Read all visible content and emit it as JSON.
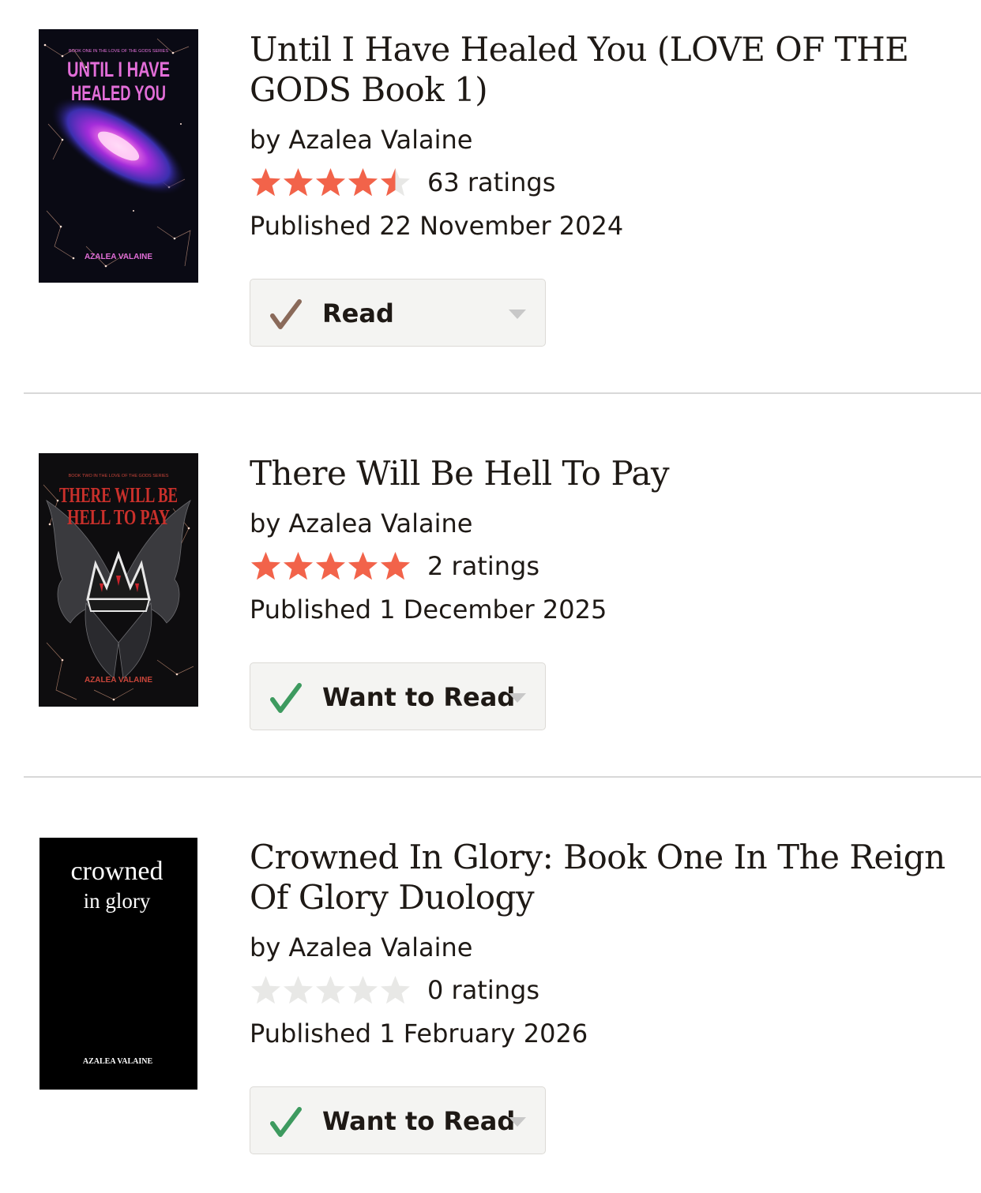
{
  "books": [
    {
      "title": "Until I Have Healed You (LOVE OF THE GODS Book 1)",
      "author_line": "by Azalea Valaine",
      "rating": 4.5,
      "ratings_label": "63 ratings",
      "published": "Published 22 November 2024",
      "shelf_label": "Read",
      "cover": {
        "series_line": "BOOK ONE IN THE LOVE OF THE GODS SERIES",
        "title_line1": "UNTIL I HAVE",
        "title_line2": "HEALED YOU",
        "author": "AZALEA VALAINE"
      }
    },
    {
      "title": "There Will Be Hell To Pay",
      "author_line": "by Azalea Valaine",
      "rating": 5,
      "ratings_label": "2 ratings",
      "published": "Published 1 December 2025",
      "shelf_label": "Want to Read",
      "cover": {
        "series_line": "BOOK TWO IN THE LOVE OF THE GODS SERIES",
        "title_line1": "THERE WILL BE",
        "title_line2": "HELL TO PAY",
        "author": "AZALEA VALAINE"
      }
    },
    {
      "title": "Crowned In Glory: Book One In The Reign Of Glory Duology",
      "author_line": "by Azalea Valaine",
      "rating": 0,
      "ratings_label": "0 ratings",
      "published": "Published 1 February 2026",
      "shelf_label": "Want to Read",
      "cover": {
        "title_line1": "crowned",
        "title_line2": "in glory",
        "author": "AZALEA VALAINE"
      }
    }
  ],
  "colors": {
    "star_filled": "#f2634a",
    "star_empty": "#e8e8e6",
    "check_read": "#8a6a5a",
    "check_want": "#3d9a5f",
    "caret": "#c8c8c8",
    "divider": "#d8d8d8"
  },
  "icons": {
    "star": "star-icon",
    "check": "check-icon",
    "caret": "chevron-down-icon"
  }
}
